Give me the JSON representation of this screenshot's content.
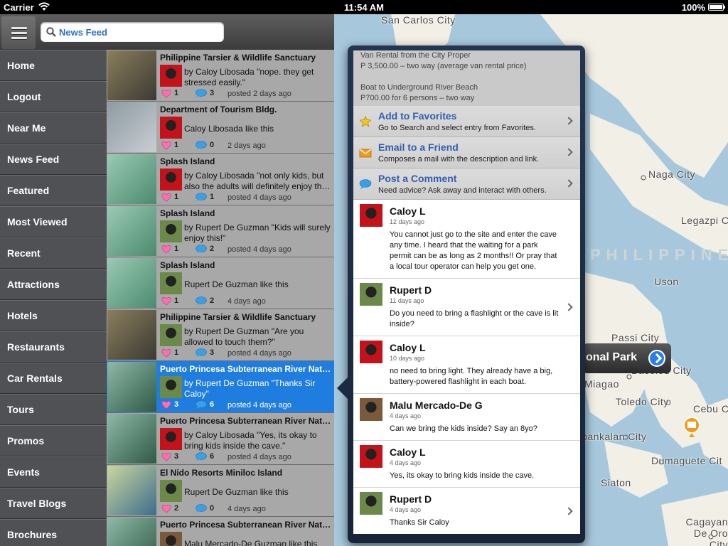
{
  "status_bar": {
    "carrier": "Carrier",
    "time": "11:54 AM",
    "battery": "100%"
  },
  "search": {
    "text": "News Feed",
    "icon": "search-icon"
  },
  "sidebar": {
    "items": [
      {
        "label": "Home"
      },
      {
        "label": "Logout"
      },
      {
        "label": "Near Me"
      },
      {
        "label": "News Feed"
      },
      {
        "label": "Featured"
      },
      {
        "label": "Most Viewed"
      },
      {
        "label": "Recent"
      },
      {
        "label": "Attractions"
      },
      {
        "label": "Hotels"
      },
      {
        "label": "Restaurants"
      },
      {
        "label": "Car Rentals"
      },
      {
        "label": "Tours"
      },
      {
        "label": "Promos"
      },
      {
        "label": "Events"
      },
      {
        "label": "Travel Blogs"
      },
      {
        "label": "Brochures"
      }
    ]
  },
  "feed": {
    "items": [
      {
        "title": "Philippine Tarsier & Wildlife Sanctuary",
        "text": "by Caloy Libosada \"nope. they get stressed easily.\"",
        "likes": "1",
        "comments": "3",
        "posted": "posted 2 days ago"
      },
      {
        "title": "Department of Tourism Bldg.",
        "text": "Caloy Libosada like this",
        "likes": "1",
        "comments": "0",
        "posted": "2 days ago"
      },
      {
        "title": "Splash Island",
        "text": "by Caloy Libosada \"not only kids, but also the adults will definitely enjoy th…",
        "likes": "1",
        "comments": "1",
        "posted": "posted 4 days ago"
      },
      {
        "title": "Splash Island",
        "text": "by Rupert De Guzman \"Kids will surely enjoy this!\"",
        "likes": "1",
        "comments": "2",
        "posted": "posted 4 days ago"
      },
      {
        "title": "Splash Island",
        "text": "Rupert De Guzman like this",
        "likes": "1",
        "comments": "2",
        "posted": "4 days ago"
      },
      {
        "title": "Philippine Tarsier & Wildlife Sanctuary",
        "text": "by Rupert De Guzman \"Are you allowed to touch them?\"",
        "likes": "1",
        "comments": "3",
        "posted": "posted 4 days ago"
      },
      {
        "title": "Puerto Princesa Subterranean River Nat…",
        "text": "by Rupert De Guzman \"Thanks Sir Caloy\"",
        "likes": "3",
        "comments": "6",
        "posted": "posted 4 days ago",
        "selected": true
      },
      {
        "title": "Puerto Princesa Subterranean River Nat…",
        "text": "by Caloy Libosada \"Yes, its okay to bring kids inside the cave.\"",
        "likes": "3",
        "comments": "6",
        "posted": "posted 4 days ago"
      },
      {
        "title": "El Nido Resorts Miniloc Island",
        "text": "Rupert De Guzman like this",
        "likes": "2",
        "comments": "0",
        "posted": "4 days ago"
      },
      {
        "title": "Puerto Princesa Subterranean River Nat…",
        "text": "Malu Mercado-De Guzman like this",
        "likes": "",
        "comments": "",
        "posted": ""
      }
    ]
  },
  "map": {
    "labels": [
      "San Carlos City",
      "Naga City",
      "Legazpi C",
      "Uson",
      "Passi City",
      "Bacolod City",
      "Miagao",
      "Toledo City",
      "Cebu C",
      "Kabankalan City",
      "Dumaguete Cit",
      "Siaton",
      "Cagayan De Oro City"
    ],
    "country": "PHILIPPINE",
    "callout": "onal Park"
  },
  "popover": {
    "info_lines": [
      "Van Rental from the City Proper",
      "P 3,500.00 – two way (average van rental price)",
      "",
      "Boat to Underground River Beach",
      "P700.00 for 6 persons – two way"
    ],
    "actions": [
      {
        "title": "Add to Favorites",
        "subtitle": "Go to Search and select entry from Favorites.",
        "icon": "star-icon"
      },
      {
        "title": "Email to a Friend",
        "subtitle": "Composes a mail with the description and link.",
        "icon": "envelope-icon"
      },
      {
        "title": "Post a Comment",
        "subtitle": "Need advice? Ask away and interact with others.",
        "icon": "speech-bubble-icon"
      }
    ],
    "comments": [
      {
        "name": "Caloy L",
        "date": "12 days ago",
        "text": "You cannot just go to the site and enter the cave any time. I heard that the waiting for a park permit can be as long as 2 months!! Or pray that a local tour operator can help you get one.",
        "chevron": false
      },
      {
        "name": "Rupert D",
        "date": "11 days ago",
        "text": "Do you need to bring a flashlight or the cave is lit inside?",
        "chevron": true
      },
      {
        "name": "Caloy L",
        "date": "10 days ago",
        "text": "no need to bring light. They already have a big, battery-powered flashlight in each boat.",
        "chevron": false
      },
      {
        "name": "Malu Mercado-De G",
        "date": "4 days ago",
        "text": "Can we bring the kids inside? Say an 8yo?",
        "chevron": false
      },
      {
        "name": "Caloy L",
        "date": "4 days ago",
        "text": "Yes, its okay to bring kids inside the cave.",
        "chevron": false
      },
      {
        "name": "Rupert D",
        "date": "4 days ago",
        "text": "Thanks Sir Caloy",
        "chevron": true
      }
    ]
  },
  "colors": {
    "accent": "#1f7de0",
    "link": "#2f5fae",
    "sidebar": "#4f5154",
    "map_water": "#a7c8dc",
    "map_land": "#f2efe6"
  }
}
